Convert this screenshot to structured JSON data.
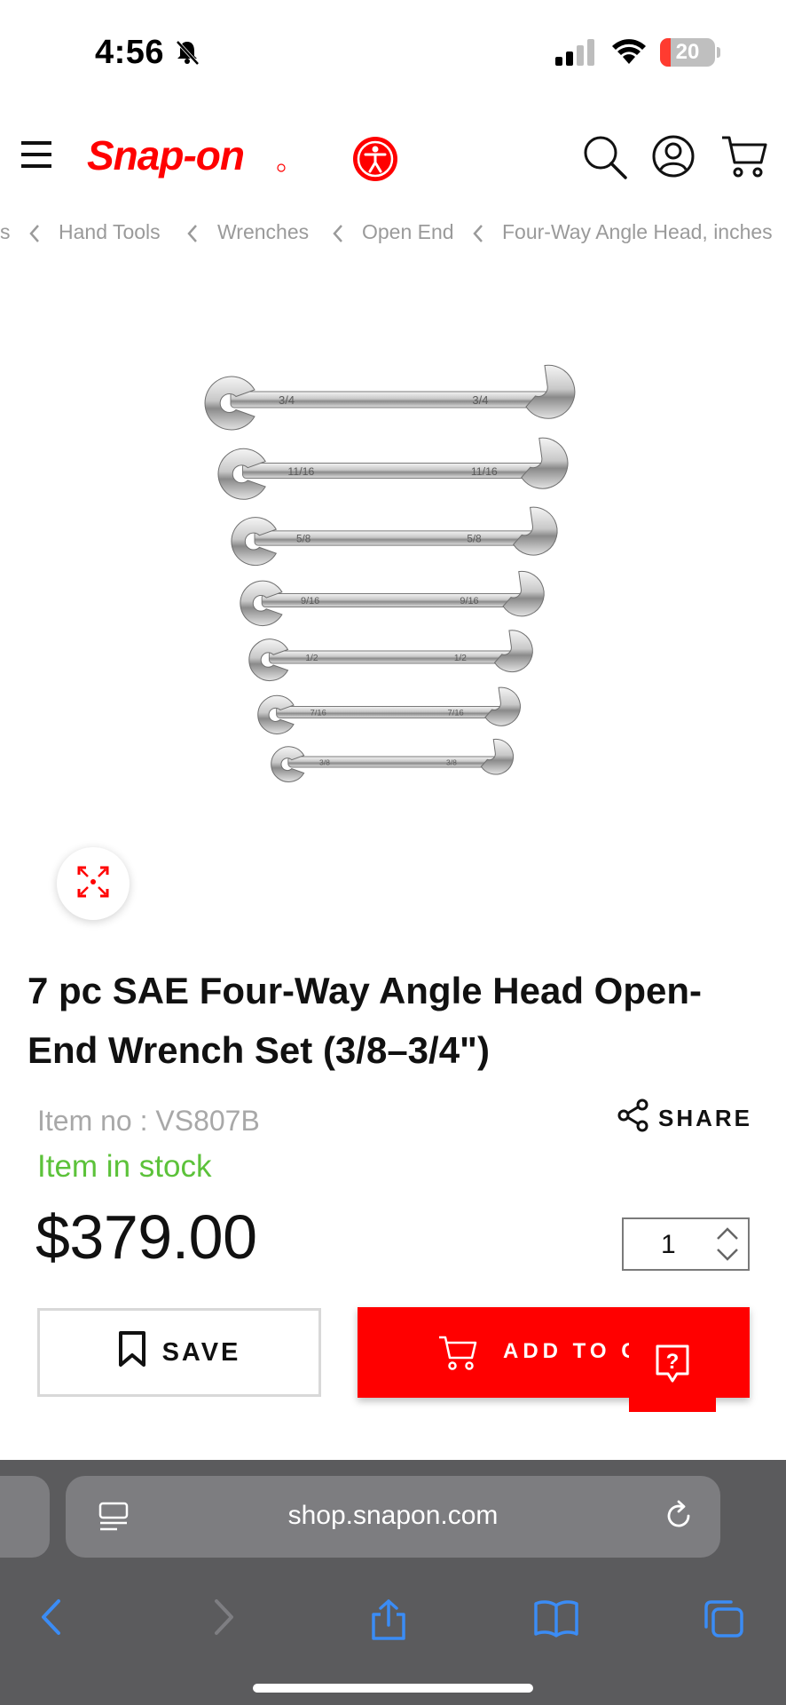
{
  "status_bar": {
    "time": "4:56",
    "battery_level": "20",
    "battery_fraction": 0.2
  },
  "header": {
    "logo_text": "Snap-on",
    "icons": [
      "menu-icon",
      "accessibility-icon",
      "search-icon",
      "account-icon",
      "cart-icon"
    ]
  },
  "breadcrumb": {
    "items": [
      "s",
      "Hand Tools",
      "Wrenches",
      "Open End",
      "Four-Way Angle Head, inches"
    ]
  },
  "product": {
    "image_sizes": [
      "3/4",
      "11/16",
      "5/8",
      "9/16",
      "1/2",
      "7/16",
      "3/8"
    ],
    "title": "7 pc SAE Four-Way Angle Head Open-End Wrench Set (3/8–3/4\")",
    "item_no": "Item no : VS807B",
    "stock_status": "Item in stock",
    "price": "$379.00",
    "quantity": "1",
    "share_label": "SHARE",
    "save_label": "SAVE",
    "add_to_cart_label": "ADD TO CART"
  },
  "browser": {
    "url": "shop.snapon.com",
    "nav_icons": [
      "back-icon",
      "forward-icon",
      "share-icon",
      "bookmarks-icon",
      "tabs-icon"
    ]
  },
  "colors": {
    "brand_red": "#ff0000",
    "stock_green": "#5cc23a",
    "browser_chrome": "#5b5b5d",
    "ios_link_blue": "#3b8cf5"
  }
}
